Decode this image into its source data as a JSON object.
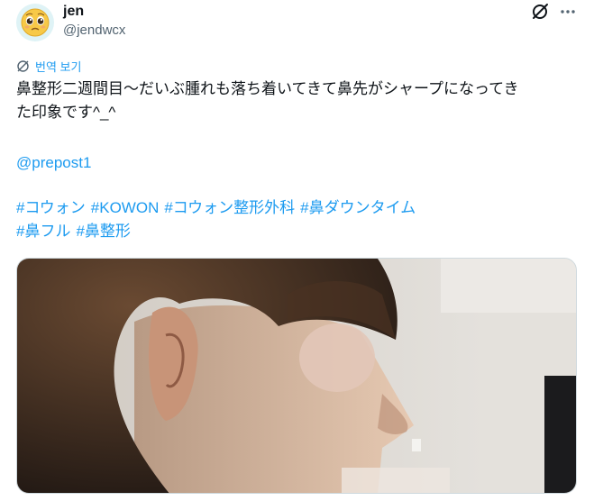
{
  "author": {
    "display_name": "jen",
    "handle": "@jendwcx",
    "avatar_icon": "pleading-face-emoji"
  },
  "actions": {
    "grok_icon": "grok-icon",
    "more_icon": "more-horizontal-icon"
  },
  "translate": {
    "label": "번역 보기",
    "icon": "translate-globe-icon"
  },
  "tweet": {
    "line1": "鼻整形二週間目〜だいぶ腫れも落ち着いてきて鼻先がシャープになってき",
    "line2": "た印象です^_^",
    "mention": "@prepost1",
    "hashtags_row1": [
      "#コウォン",
      "#KOWON",
      "#コウォン整形外科",
      "#鼻ダウンタイム"
    ],
    "hashtags_row2": [
      "#鼻フル",
      "#鼻整形"
    ]
  },
  "media": {
    "type": "photo",
    "description_icon": "profile-photo"
  },
  "colors": {
    "link": "#1d9bf0",
    "text": "#0f1419",
    "secondary": "#536471",
    "border": "#cfd9de"
  }
}
